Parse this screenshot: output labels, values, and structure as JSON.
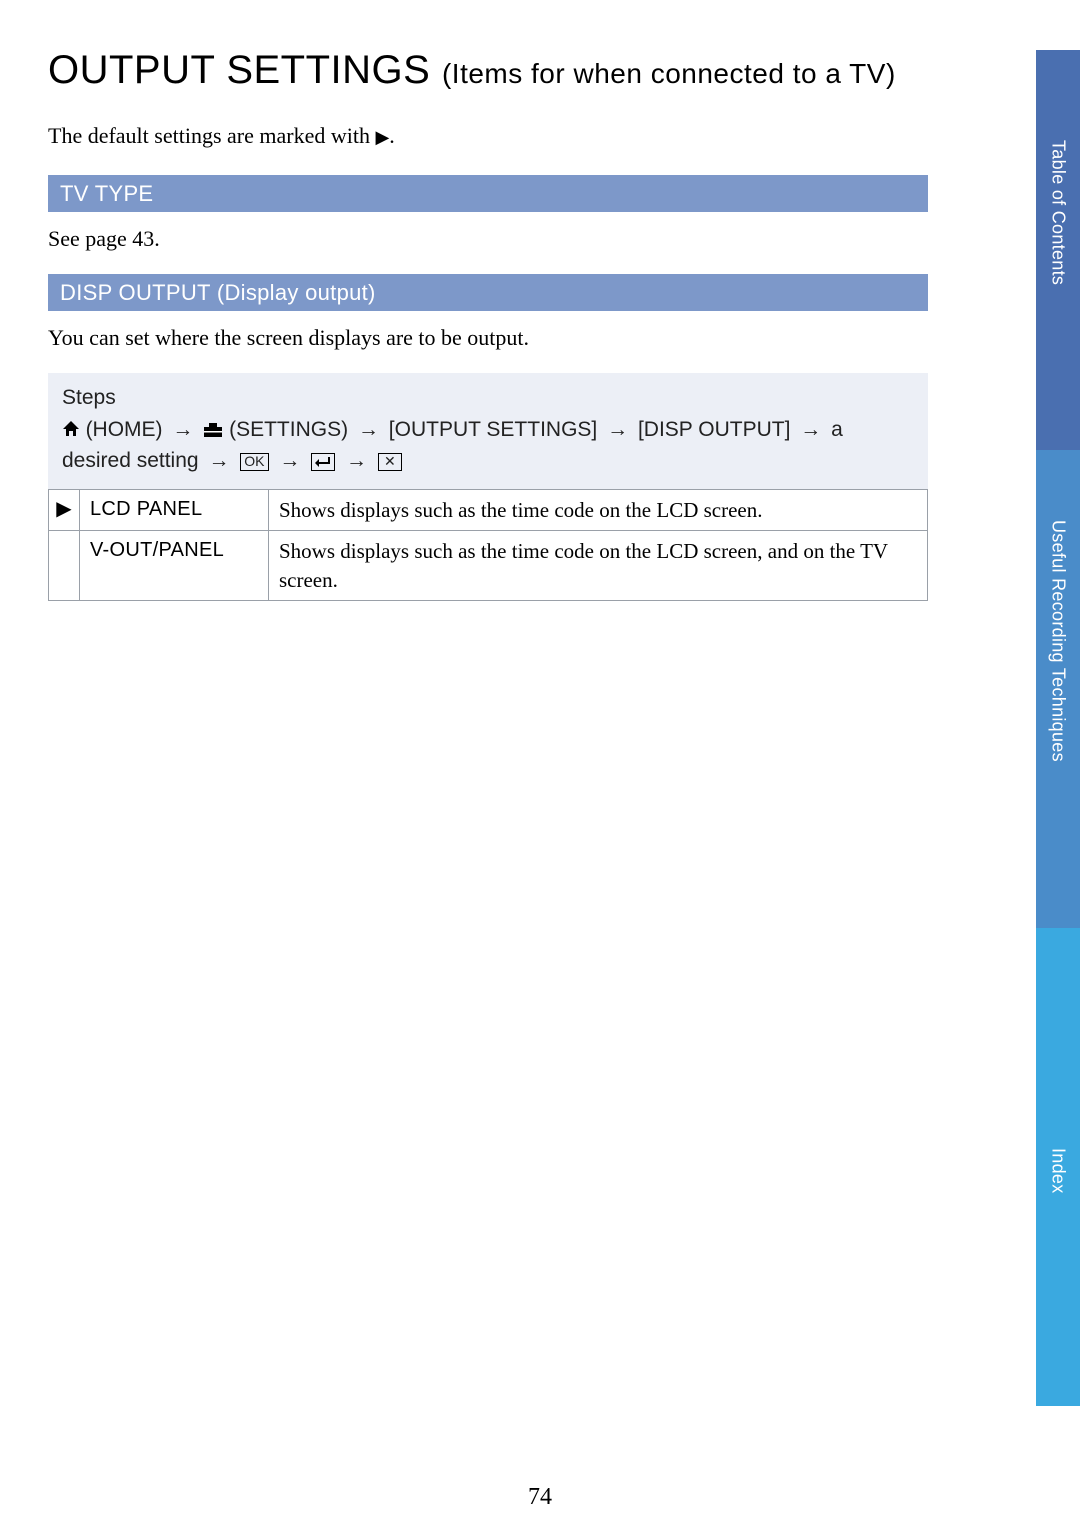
{
  "title": {
    "main": "OUTPUT SETTINGS",
    "sub": "(Items for when connected to a TV)"
  },
  "intro_prefix": "The default settings are marked with ",
  "intro_marker": "▶",
  "intro_suffix": ".",
  "sections": {
    "tv_type": {
      "header": "TV TYPE",
      "body": "See page 43."
    },
    "disp_output": {
      "header": "DISP OUTPUT (Display output)",
      "body": "You can set where the screen displays are to be output."
    }
  },
  "steps": {
    "label": "Steps",
    "home": "(HOME)",
    "settings": "(SETTINGS)",
    "output_settings": "[OUTPUT SETTINGS]",
    "disp_output": "[DISP OUTPUT]",
    "desired": "a desired setting",
    "arrow": "→",
    "ok": "OK",
    "x": "✕"
  },
  "options": [
    {
      "default": "▶",
      "name": "LCD PANEL",
      "desc": "Shows displays such as the time code on the LCD screen."
    },
    {
      "default": "",
      "name": "V-OUT/PANEL",
      "desc": "Shows displays such as the time code on the LCD screen, and on the TV screen."
    }
  ],
  "side_tabs": {
    "toc": "Table of Contents",
    "urt": "Useful Recording Techniques",
    "idx": "Index"
  },
  "page_number": "74"
}
